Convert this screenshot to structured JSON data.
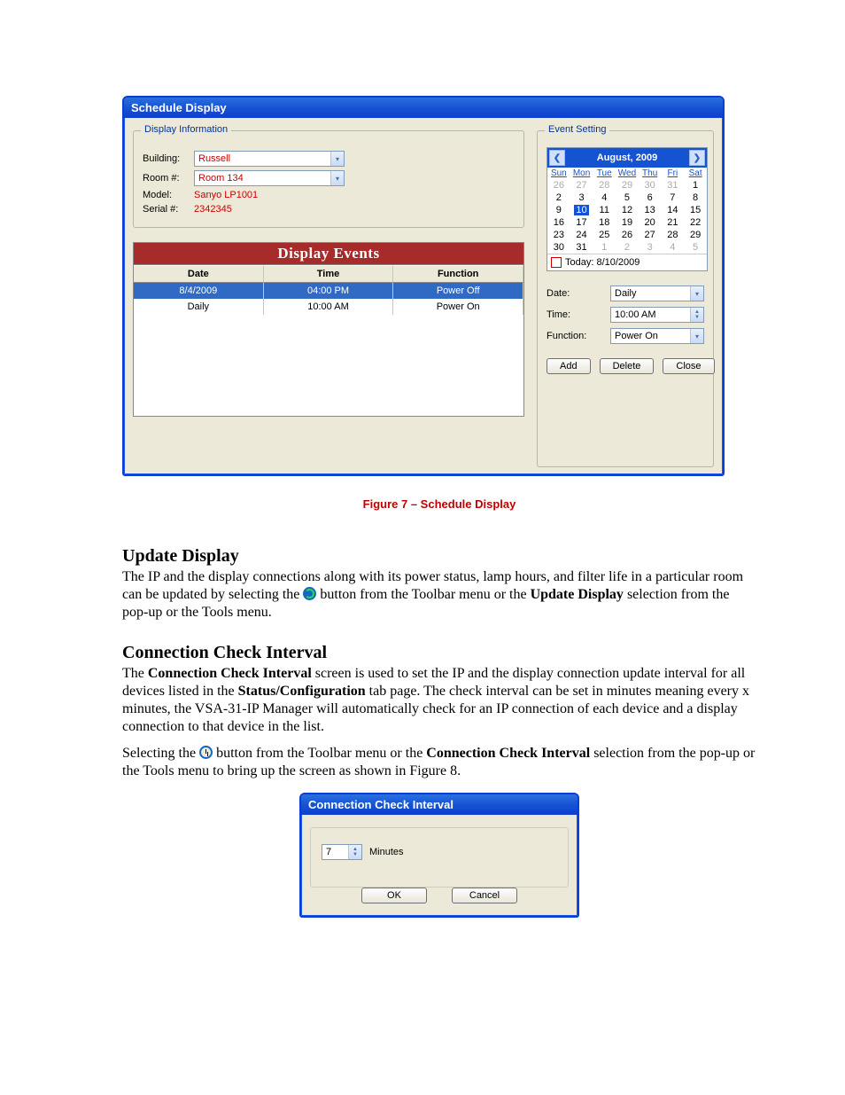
{
  "schedule_window": {
    "title": "Schedule Display",
    "display_info": {
      "legend": "Display Information",
      "building_label": "Building:",
      "building_value": "Russell",
      "room_label": "Room #:",
      "room_value": "Room 134",
      "model_label": "Model:",
      "model_value": "Sanyo LP1001",
      "serial_label": "Serial #:",
      "serial_value": "2342345"
    },
    "events": {
      "header": "Display Events",
      "cols": [
        "Date",
        "Time",
        "Function"
      ],
      "rows": [
        {
          "date": "8/4/2009",
          "time": "04:00 PM",
          "func": "Power Off",
          "selected": true
        },
        {
          "date": "Daily",
          "time": "10:00 AM",
          "func": "Power On",
          "selected": false
        }
      ]
    },
    "event_setting": {
      "legend": "Event Setting",
      "month_title": "August, 2009",
      "dow": [
        "Sun",
        "Mon",
        "Tue",
        "Wed",
        "Thu",
        "Fri",
        "Sat"
      ],
      "today_label": "Today: 8/10/2009",
      "selected_day": 10,
      "date_label": "Date:",
      "date_value": "Daily",
      "time_label": "Time:",
      "time_value": "10:00 AM",
      "function_label": "Function:",
      "function_value": "Power On",
      "buttons": {
        "add": "Add",
        "delete": "Delete",
        "close": "Close"
      }
    }
  },
  "caption": "Figure 7 – Schedule Display",
  "sec1": {
    "heading": "Update Display",
    "p1a": "The IP and the display connections along with its power status, lamp hours, and filter life in a particular room can be updated by selecting the ",
    "p1b": " button from the Toolbar menu or the ",
    "bold1": "Update Display",
    "p1c": " selection from the pop-up or the Tools menu."
  },
  "sec2": {
    "heading": "Connection Check Interval",
    "p1a": "The ",
    "bold1": "Connection Check Interval",
    "p1b": " screen is used to set the IP and the display connection update interval for all devices listed in the ",
    "bold2": "Status/Configuration",
    "p1c": " tab page.  The check interval can be set in minutes meaning every x minutes, the VSA-31-IP Manager will automatically check for an IP connection of each device and a display connection to that device in the list.",
    "p2a": "Selecting the ",
    "p2b": " button from the Toolbar menu or the ",
    "bold3": "Connection Check Interval",
    "p2c": " selection from the pop-up or the Tools menu to bring up the screen as shown in Figure 8."
  },
  "cci_window": {
    "title": "Connection Check Interval",
    "value": "7",
    "unit": "Minutes",
    "ok": "OK",
    "cancel": "Cancel"
  },
  "chart_data": {
    "type": "table",
    "title": "Display Events",
    "columns": [
      "Date",
      "Time",
      "Function"
    ],
    "rows": [
      [
        "8/4/2009",
        "04:00 PM",
        "Power Off"
      ],
      [
        "Daily",
        "10:00 AM",
        "Power On"
      ]
    ]
  }
}
